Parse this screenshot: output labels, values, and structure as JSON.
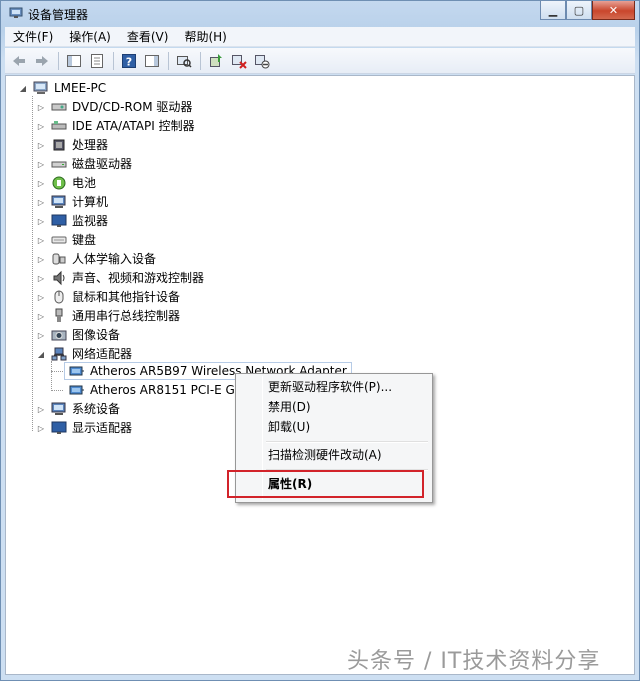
{
  "window": {
    "title": "设备管理器"
  },
  "menubar": [
    {
      "label": "文件(F)"
    },
    {
      "label": "操作(A)"
    },
    {
      "label": "查看(V)"
    },
    {
      "label": "帮助(H)"
    }
  ],
  "toolbar": {
    "icons": [
      "back-icon",
      "forward-icon",
      "show-hide-console-tree-icon",
      "properties-icon",
      "help-icon",
      "action-pane-icon",
      "scan-hardware-icon",
      "update-driver-icon",
      "uninstall-icon",
      "disable-icon"
    ]
  },
  "tree": {
    "root": {
      "label": "LMEE-PC",
      "expanded": true
    },
    "categories": [
      {
        "label": "DVD/CD-ROM 驱动器",
        "icon": "dvd-drive-icon"
      },
      {
        "label": "IDE ATA/ATAPI 控制器",
        "icon": "ide-controller-icon"
      },
      {
        "label": "处理器",
        "icon": "processor-icon"
      },
      {
        "label": "磁盘驱动器",
        "icon": "disk-drive-icon"
      },
      {
        "label": "电池",
        "icon": "battery-icon"
      },
      {
        "label": "计算机",
        "icon": "computer-icon"
      },
      {
        "label": "监视器",
        "icon": "monitor-icon"
      },
      {
        "label": "键盘",
        "icon": "keyboard-icon"
      },
      {
        "label": "人体学输入设备",
        "icon": "hid-icon"
      },
      {
        "label": "声音、视频和游戏控制器",
        "icon": "sound-icon"
      },
      {
        "label": "鼠标和其他指针设备",
        "icon": "mouse-icon"
      },
      {
        "label": "通用串行总线控制器",
        "icon": "usb-icon"
      },
      {
        "label": "图像设备",
        "icon": "imaging-device-icon"
      },
      {
        "label": "网络适配器",
        "icon": "network-adapter-icon",
        "expanded": true
      },
      {
        "label": "系统设备",
        "icon": "system-device-icon"
      },
      {
        "label": "显示适配器",
        "icon": "display-adapter-icon"
      }
    ],
    "network_children": [
      {
        "label": "Atheros AR5B97 Wireless Network Adapter",
        "selected": true
      },
      {
        "label": "Atheros AR8151 PCI-E Giga"
      }
    ]
  },
  "context_menu": {
    "items": [
      {
        "label": "更新驱动程序软件(P)..."
      },
      {
        "label": "禁用(D)"
      },
      {
        "label": "卸载(U)"
      },
      {
        "label": "扫描检测硬件改动(A)"
      },
      {
        "label": "属性(R)",
        "bold": true
      }
    ]
  },
  "watermark": "头条号 / IT技术资料分享",
  "colors": {
    "highlight_box": "#d2232a",
    "close_button": "#c9462c"
  }
}
